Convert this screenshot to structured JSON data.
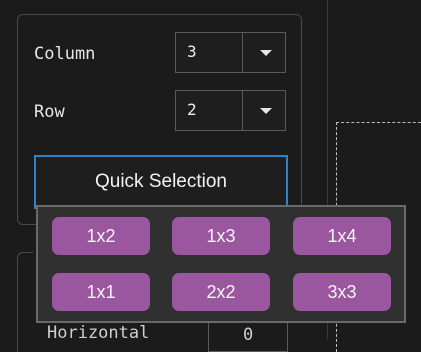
{
  "settings": {
    "column": {
      "label": "Column",
      "value": "3"
    },
    "row": {
      "label": "Row",
      "value": "2"
    },
    "quick_selection_label": "Quick Selection"
  },
  "quick_selection_popup": {
    "options": [
      "1x2",
      "1x3",
      "1x4",
      "1x1",
      "2x2",
      "3x3"
    ]
  },
  "next_group": {
    "label": "Horizontal",
    "value": "0"
  },
  "colors": {
    "background": "#1b1b1b",
    "option_button": "#9b56a0",
    "focus_border": "#2f82c8"
  },
  "icons": [
    "chevron-down-icon"
  ]
}
